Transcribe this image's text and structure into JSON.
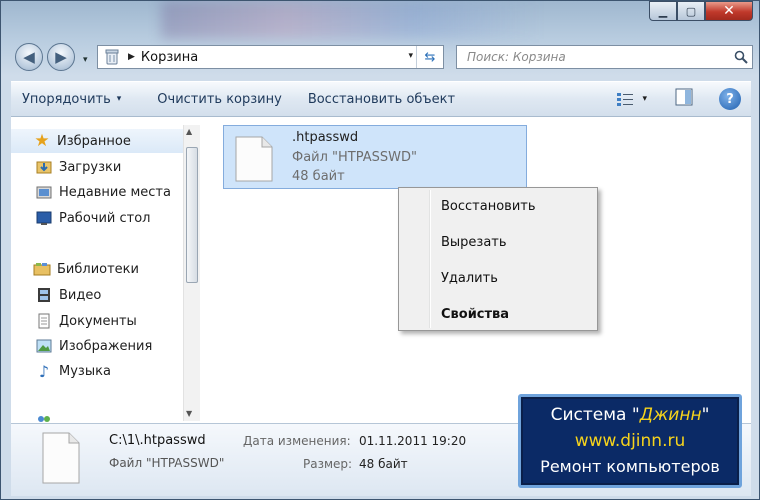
{
  "window": {
    "minimize": "▁",
    "maximize": "▢",
    "close": "✕"
  },
  "nav": {
    "back": "◀",
    "forward": "▶",
    "menu": "▾"
  },
  "address": {
    "separator": "▶",
    "location": "Корзина",
    "dropdown": "▾",
    "refresh": "⇆"
  },
  "search": {
    "placeholder": "Поиск: Корзина"
  },
  "toolbar": {
    "organize": "Упорядочить",
    "organize_arrow": "▾",
    "empty_bin": "Очистить корзину",
    "restore_object": "Восстановить объект",
    "view_arrow": "▾",
    "help": "?"
  },
  "sidebar": {
    "favorites": "Избранное",
    "downloads": "Загрузки",
    "recent": "Недавние места",
    "desktop": "Рабочий стол",
    "libraries": "Библиотеки",
    "video": "Видео",
    "documents": "Документы",
    "images": "Изображения",
    "music": "Музыка"
  },
  "file": {
    "name": ".htpasswd",
    "type": "Файл \"HTPASSWD\"",
    "size": "48 байт"
  },
  "context_menu": {
    "restore": "Восстановить",
    "cut": "Вырезать",
    "delete": "Удалить",
    "properties": "Свойства"
  },
  "status": {
    "path": "C:\\1\\.htpasswd",
    "type": "Файл \"HTPASSWD\"",
    "modified_label": "Дата изменения:",
    "modified_value": "01.11.2011 19:20",
    "size_label": "Размер:",
    "size_value": "48 байт"
  },
  "promo": {
    "line1_prefix": "Система \"",
    "line1_name": "Джинн",
    "line1_suffix": "\"",
    "line2": "www.djinn.ru",
    "line3": "Ремонт компьютеров"
  },
  "colors": {
    "selection": "#cfe4fa",
    "promo_bg": "#0b2a66",
    "promo_accent": "#f6d31c",
    "close_button": "#c0392b"
  }
}
